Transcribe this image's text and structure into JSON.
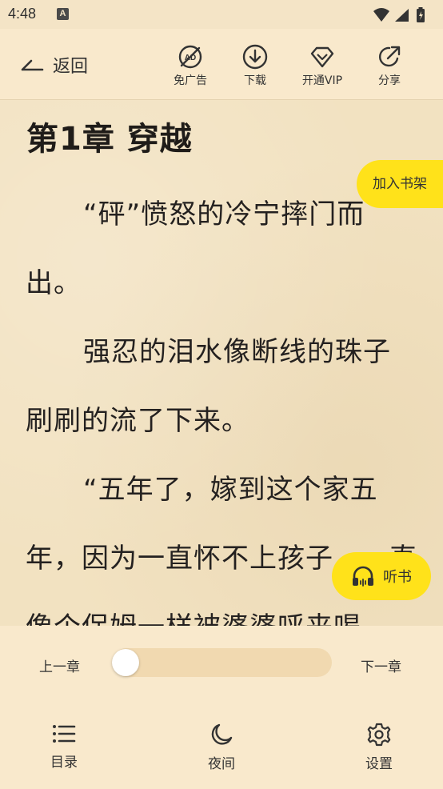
{
  "status_bar": {
    "time": "4:48",
    "notif_letter": "A"
  },
  "toolbar": {
    "back_label": "返回",
    "tools": [
      {
        "label": "免广告",
        "icon": "no-ads-icon"
      },
      {
        "label": "下载",
        "icon": "download-icon"
      },
      {
        "label": "开通VIP",
        "icon": "vip-diamond-icon"
      },
      {
        "label": "分享",
        "icon": "share-icon"
      }
    ]
  },
  "reader": {
    "chapter_title": "第1章 穿越",
    "paragraphs": [
      "“砰”愤怒的冷宁摔门而出。",
      "强忍的泪水像断线的珠子刷刷的流了下来。",
      "“五年了，嫁到这个家五年，因为一直怀不上孩子，一直像个保姆一样被婆婆呼来喝"
    ]
  },
  "floating": {
    "add_shelf": "加入书架",
    "listen": "听书"
  },
  "bottom": {
    "prev_chapter": "上一章",
    "next_chapter": "下一章",
    "progress": 0,
    "nav": [
      {
        "label": "目录",
        "icon": "list-icon"
      },
      {
        "label": "夜间",
        "icon": "moon-icon"
      },
      {
        "label": "设置",
        "icon": "gear-icon"
      }
    ]
  },
  "colors": {
    "accent": "#ffe21a",
    "background": "#f4e4c6",
    "panel": "#f9e9cc"
  }
}
